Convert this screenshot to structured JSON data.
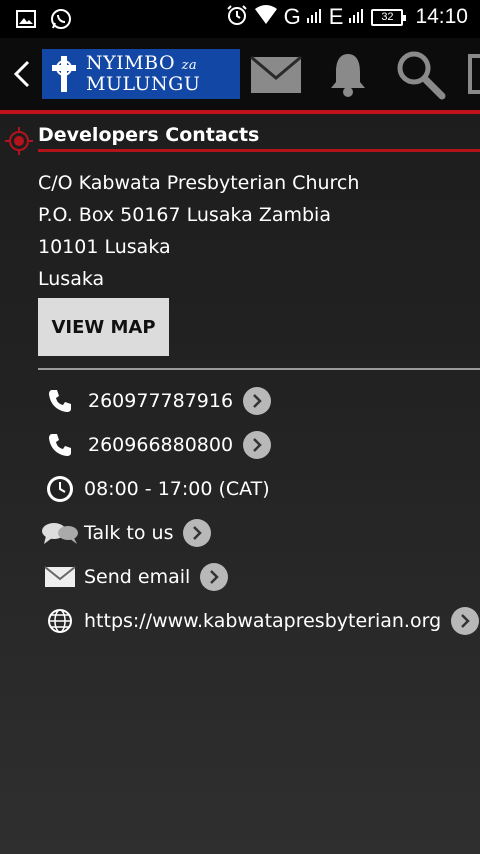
{
  "status_bar": {
    "time": "14:10",
    "network_1": "G",
    "network_2": "E",
    "battery": "32"
  },
  "action_bar": {
    "logo_line1": "Nyimbo",
    "logo_za": "za",
    "logo_line2": "Mulungu"
  },
  "section": {
    "title": "Developers Contacts"
  },
  "address": {
    "lines": [
      "C/O Kabwata Presbyterian Church",
      "P.O. Box 50167 Lusaka Zambia",
      "10101 Lusaka",
      "Lusaka"
    ]
  },
  "view_map_label": "VIEW MAP",
  "contacts": {
    "phone_1": "260977787916",
    "phone_2": "260966880800",
    "hours": "08:00 - 17:00 (CAT)",
    "talk": "Talk to us",
    "email": "Send email",
    "website": "https://www.kabwatapresbyterian.org"
  },
  "colors": {
    "accent_red": "#c0121a",
    "logo_blue": "#1347a6"
  }
}
